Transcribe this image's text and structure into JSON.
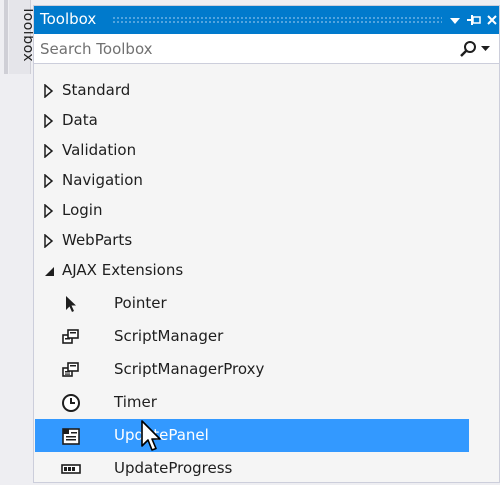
{
  "side_tab": {
    "label": "Toolbox"
  },
  "panel": {
    "title": "Toolbox",
    "buttons": {
      "dropdown_icon": "dropdown-arrow",
      "pin_icon": "pin",
      "close_icon": "close"
    }
  },
  "search": {
    "placeholder": "Search Toolbox",
    "value": "",
    "icon": "search"
  },
  "categories": [
    {
      "label": "Standard",
      "expanded": false
    },
    {
      "label": "Data",
      "expanded": false
    },
    {
      "label": "Validation",
      "expanded": false
    },
    {
      "label": "Navigation",
      "expanded": false
    },
    {
      "label": "Login",
      "expanded": false
    },
    {
      "label": "WebParts",
      "expanded": false
    },
    {
      "label": "AJAX Extensions",
      "expanded": true
    }
  ],
  "tools": [
    {
      "label": "Pointer",
      "icon": "pointer",
      "selected": false
    },
    {
      "label": "ScriptManager",
      "icon": "script-manager",
      "selected": false
    },
    {
      "label": "ScriptManagerProxy",
      "icon": "script-manager-proxy",
      "selected": false
    },
    {
      "label": "Timer",
      "icon": "timer",
      "selected": false
    },
    {
      "label": "UpdatePanel",
      "icon": "update-panel",
      "selected": true
    },
    {
      "label": "UpdateProgress",
      "icon": "update-progress",
      "selected": false
    }
  ],
  "colors": {
    "accent": "#007acc",
    "selection": "#3399ff",
    "panel_bg": "#f5f5f5",
    "text": "#1e1e1e"
  }
}
